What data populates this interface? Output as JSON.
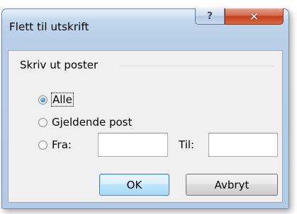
{
  "dialog": {
    "title": "Flett til utskrift",
    "help_icon": "question-mark-icon",
    "close_icon": "close-x-icon",
    "help_glyph": "?",
    "close_glyph": "✕"
  },
  "group": {
    "label": "Skriv ut poster",
    "options": [
      {
        "label": "Alle",
        "checked": true
      },
      {
        "label": "Gjeldende post",
        "checked": false
      },
      {
        "label": "Fra:",
        "checked": false
      }
    ],
    "from_value": "",
    "to_label": "Til:",
    "to_value": ""
  },
  "buttons": {
    "ok": "OK",
    "cancel": "Avbryt"
  },
  "colors": {
    "accent": "#3a8ed0",
    "close_red": "#c4411f",
    "frame": "#b3cbe4"
  }
}
